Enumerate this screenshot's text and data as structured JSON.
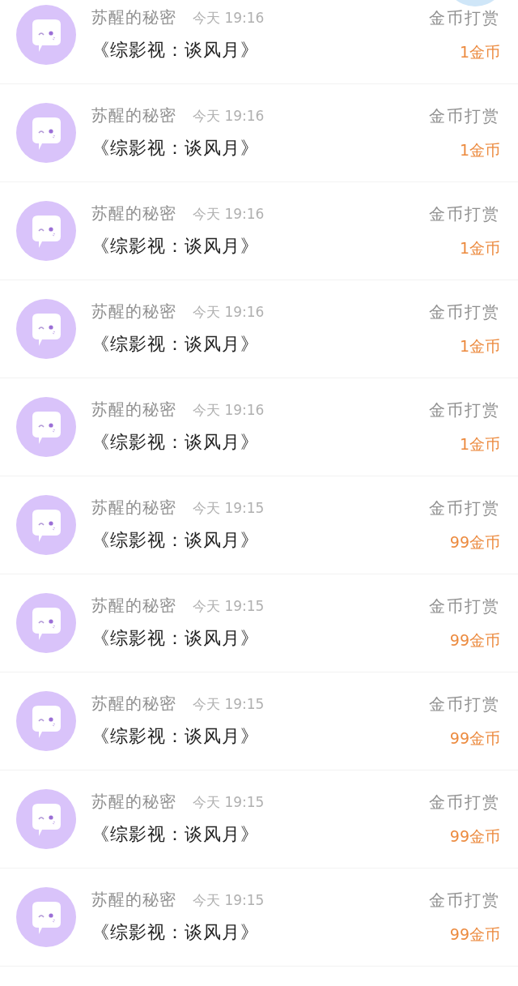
{
  "rows": [
    {
      "sender": "苏醒的秘密",
      "time": "今天 19:16",
      "title": "《综影视：谈风月》",
      "type": "金币打赏",
      "amount": "1金币"
    },
    {
      "sender": "苏醒的秘密",
      "time": "今天 19:16",
      "title": "《综影视：谈风月》",
      "type": "金币打赏",
      "amount": "1金币"
    },
    {
      "sender": "苏醒的秘密",
      "time": "今天 19:16",
      "title": "《综影视：谈风月》",
      "type": "金币打赏",
      "amount": "1金币"
    },
    {
      "sender": "苏醒的秘密",
      "time": "今天 19:16",
      "title": "《综影视：谈风月》",
      "type": "金币打赏",
      "amount": "1金币"
    },
    {
      "sender": "苏醒的秘密",
      "time": "今天 19:16",
      "title": "《综影视：谈风月》",
      "type": "金币打赏",
      "amount": "1金币"
    },
    {
      "sender": "苏醒的秘密",
      "time": "今天 19:15",
      "title": "《综影视：谈风月》",
      "type": "金币打赏",
      "amount": "99金币"
    },
    {
      "sender": "苏醒的秘密",
      "time": "今天 19:15",
      "title": "《综影视：谈风月》",
      "type": "金币打赏",
      "amount": "99金币"
    },
    {
      "sender": "苏醒的秘密",
      "time": "今天 19:15",
      "title": "《综影视：谈风月》",
      "type": "金币打赏",
      "amount": "99金币"
    },
    {
      "sender": "苏醒的秘密",
      "time": "今天 19:15",
      "title": "《综影视：谈风月》",
      "type": "金币打赏",
      "amount": "99金币"
    },
    {
      "sender": "苏醒的秘密",
      "time": "今天 19:15",
      "title": "《综影视：谈风月》",
      "type": "金币打赏",
      "amount": "99金币"
    }
  ]
}
